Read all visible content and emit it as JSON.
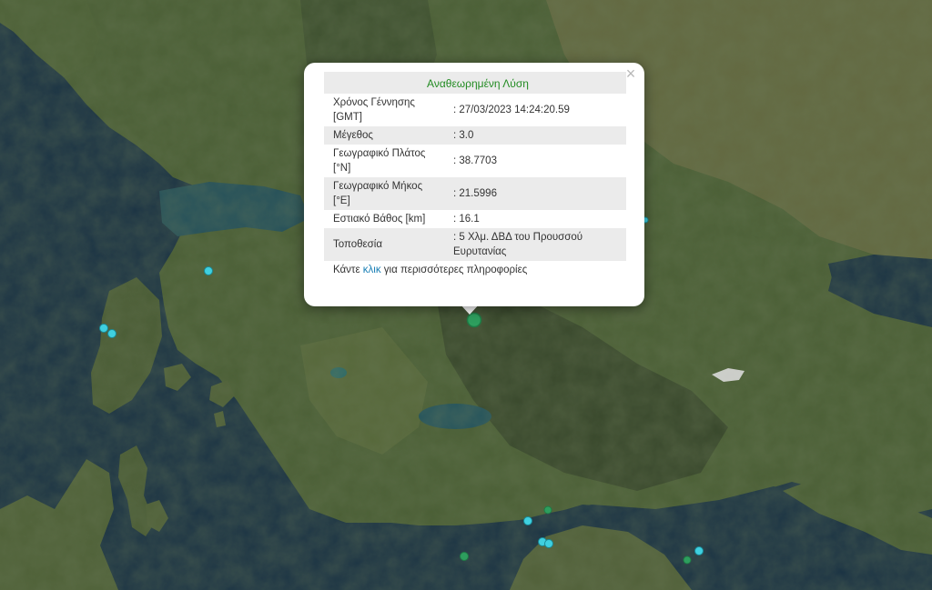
{
  "popup": {
    "title": "Αναθεωρημένη Λύση",
    "close_symbol": "×",
    "rows": [
      {
        "label": "Χρόνος Γέννησης [GMT]",
        "value": ": 27/03/2023 14:24:20.59"
      },
      {
        "label": "Μέγεθος",
        "value": ": 3.0"
      },
      {
        "label": "Γεωγραφικό Πλάτος [°N]",
        "value": ": 38.7703"
      },
      {
        "label": "Γεωγραφικό Μήκος [°E]",
        "value": ": 21.5996"
      },
      {
        "label": "Εστιακό Βάθος [km]",
        "value": ": 16.1"
      },
      {
        "label": "Τοποθεσία",
        "value": ": 5 Χλμ. ΔΒΔ του Προυσσού Ευρυτανίας"
      }
    ],
    "more_prefix": "Κάντε ",
    "more_link": "κλικ",
    "more_suffix": " για περισσότερες πληροφορίες"
  },
  "map_colors": {
    "sea": "#1b3344",
    "land_green": "#3f5a32",
    "land_olive": "#5c6a3e",
    "mountain": "#3a4a2e",
    "lake": "#2a5f66",
    "marker_green": "#2e9e5e",
    "marker_cyan": "#3fd0e0"
  },
  "markers": [
    {
      "type": "selected",
      "color": "green"
    },
    {
      "type": "event",
      "color": "cyan"
    },
    {
      "type": "event",
      "color": "green"
    }
  ]
}
